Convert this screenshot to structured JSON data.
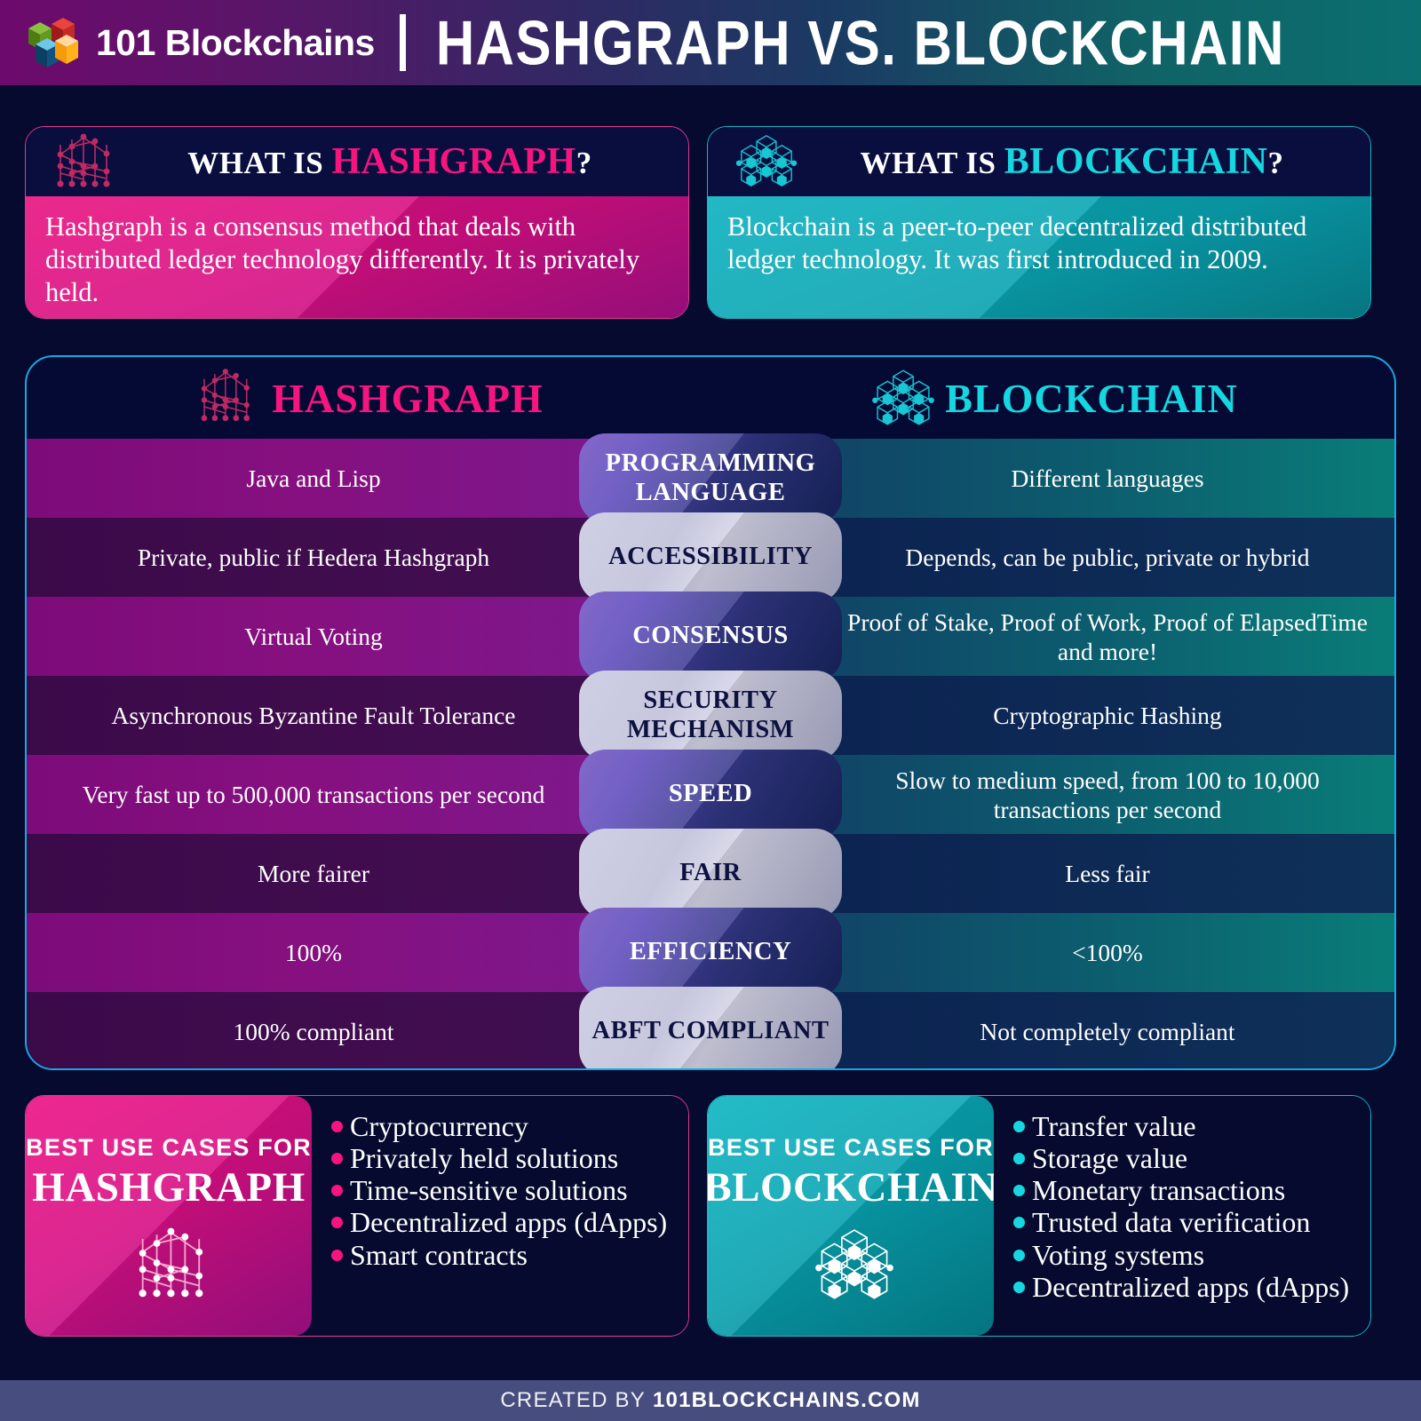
{
  "header": {
    "brand": "101 Blockchains",
    "title": "HASHGRAPH VS. BLOCKCHAIN",
    "logo_icon": "four-cubes-logo-icon",
    "divider": "header-divider",
    "colors": {
      "purple": "#6d0a6d",
      "navy": "#1b2a5e",
      "teal": "#0b6f70"
    }
  },
  "definitions": {
    "hashgraph": {
      "icon": "hashgraph-dag-icon",
      "title_prefix": "WHAT IS ",
      "title_accent": "HASHGRAPH",
      "title_suffix": "?",
      "body": "Hashgraph is a consensus method that deals with distributed ledger technology differently. It is privately held.",
      "accent_color": "#f6157f"
    },
    "blockchain": {
      "icon": "blockchain-cubes-icon",
      "title_prefix": "WHAT IS ",
      "title_accent": "BLOCKCHAIN",
      "title_suffix": "?",
      "body": "Blockchain is a peer-to-peer decentralized distributed ledger technology. It was first introduced in 2009.",
      "accent_color": "#16d6e0"
    }
  },
  "comparison": {
    "left_header": {
      "label": "HASHGRAPH",
      "icon": "hashgraph-dag-icon",
      "color": "#f6157f"
    },
    "right_header": {
      "label": "BLOCKCHAIN",
      "icon": "blockchain-cubes-icon",
      "color": "#16d6e0"
    },
    "rows": [
      {
        "attribute": "PROGRAMMING LANGUAGE",
        "hashgraph": "Java and Lisp",
        "blockchain": "Different languages"
      },
      {
        "attribute": "ACCESSIBILITY",
        "hashgraph": "Private, public if Hedera Hashgraph",
        "blockchain": "Depends, can be public, private or hybrid"
      },
      {
        "attribute": "CONSENSUS",
        "hashgraph": "Virtual Voting",
        "blockchain": "Proof of Stake, Proof of Work, Proof of ElapsedTime and more!"
      },
      {
        "attribute": "SECURITY MECHANISM",
        "hashgraph": "Asynchronous Byzantine Fault Tolerance",
        "blockchain": "Cryptographic Hashing"
      },
      {
        "attribute": "SPEED",
        "hashgraph": "Very fast up to 500,000 transactions per second",
        "blockchain": "Slow to medium speed, from 100 to 10,000 transactions per second"
      },
      {
        "attribute": "FAIR",
        "hashgraph": "More fairer",
        "blockchain": "Less fair"
      },
      {
        "attribute": "EFFICIENCY",
        "hashgraph": "100%",
        "blockchain": "<100%"
      },
      {
        "attribute": "ABFT COMPLIANT",
        "hashgraph": "100% compliant",
        "blockchain": "Not completely compliant"
      }
    ]
  },
  "use_cases": {
    "hashgraph": {
      "badge_line1": "BEST USE CASES FOR",
      "badge_line2": "HASHGRAPH",
      "icon": "hashgraph-dag-icon",
      "items": [
        "Cryptocurrency",
        "Privately held solutions",
        "Time-sensitive solutions",
        "Decentralized apps (dApps)",
        "Smart contracts"
      ]
    },
    "blockchain": {
      "badge_line1": "BEST USE CASES FOR",
      "badge_line2": "BLOCKCHAIN",
      "icon": "blockchain-cubes-icon",
      "items": [
        "Transfer value",
        "Storage value",
        "Monetary transactions",
        "Trusted data verification",
        "Voting systems",
        "Decentralized apps (dApps)"
      ]
    }
  },
  "footer": {
    "prefix": "CREATED BY",
    "site": "101BLOCKCHAINS.COM"
  }
}
